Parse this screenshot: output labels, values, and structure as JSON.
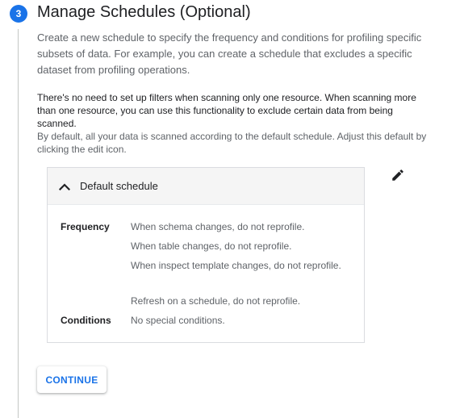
{
  "step": {
    "number": "3",
    "title": "Manage Schedules (Optional)",
    "description": "Create a new schedule to specify the frequency and conditions for profiling specific subsets of data. For example, you can create a schedule that excludes a specific dataset from profiling operations."
  },
  "notes": {
    "filter_note": "There's no need to set up filters when scanning only one resource. When scanning more than one resource, you can use this functionality to exclude certain data from being scanned.",
    "default_note": "By default, all your data is scanned according to the default schedule. Adjust this default by clicking the edit icon."
  },
  "schedule_panel": {
    "title": "Default schedule",
    "expanded": true,
    "frequency_label": "Frequency",
    "frequency_items": [
      "When schema changes, do not reprofile.",
      "When table changes, do not reprofile.",
      "When inspect template changes, do not reprofile.",
      "Refresh on a schedule, do not reprofile."
    ],
    "conditions_label": "Conditions",
    "conditions_value": "No special conditions."
  },
  "edit_icon": "pencil-icon",
  "collapse_icon": "chevron-up-icon",
  "actions": {
    "continue_label": "CONTINUE"
  },
  "colors": {
    "accent": "#1a73e8",
    "text_primary": "#202124",
    "text_secondary": "#5f6368",
    "panel_header_bg": "#f5f5f5",
    "border": "#dadce0"
  }
}
